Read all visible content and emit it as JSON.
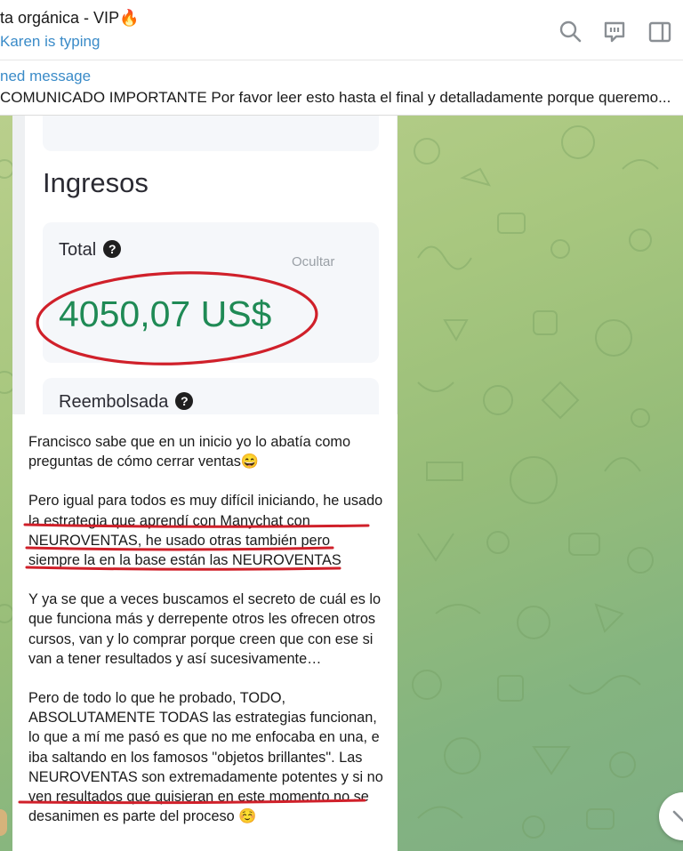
{
  "header": {
    "title": "ta orgánica - VIP🔥",
    "status": "Karen is typing",
    "icons": [
      "search-icon",
      "comments-icon",
      "sidebar-toggle-icon"
    ]
  },
  "pinned": {
    "label": "ned message",
    "text": "COMUNICADO IMPORTANTE Por favor leer esto hasta el final y detalladamente porque queremo..."
  },
  "screenshot": {
    "section_title": "Ingresos",
    "total_label": "Total",
    "hide_label": "Ocultar",
    "total_amount": "4050,07 US$",
    "refunded_label": "Reembolsada",
    "accent_color": "#1f8a55",
    "circle_color": "#d0202a"
  },
  "message": {
    "paragraphs": [
      "Francisco sabe que en un inicio yo lo abatía como preguntas de cómo cerrar ventas😄",
      "Pero igual para todos es muy difícil iniciando, he usado la estrategia que aprendí con Manychat con NEUROVENTAS, he usado otras también pero siempre la en la base están las NEUROVENTAS",
      "Y ya se que a veces buscamos el secreto de cuál es lo que funciona más y derrepente otros les ofrecen otros cursos, van y lo comprar porque creen que con ese si van a tener resultados y así sucesivamente…",
      "Pero de todo lo que he probado, TODO, ABSOLUTAMENTE TODAS las estrategias funcionan, lo que a mí me pasó es que no me enfocaba en una, e iba saltando en los famosos \"objetos brillantes\". Las NEUROVENTAS son extremadamente potentes y si no ven resultados que quisieran en este momento no se desanimen es parte del proceso ☺️"
    ],
    "underline_color": "#d0202a"
  },
  "colors": {
    "link_blue": "#3a8bc8",
    "chat_bg": "#a8c77f"
  }
}
